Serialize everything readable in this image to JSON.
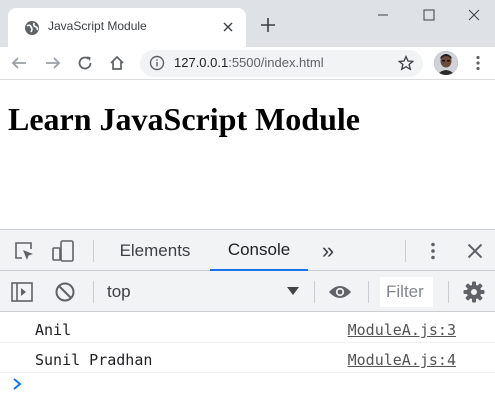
{
  "browser": {
    "tab_title": "JavaScript Module",
    "url_host": "127.0.0.1",
    "url_rest": ":5500/index.html"
  },
  "page": {
    "heading": "Learn JavaScript Module"
  },
  "devtools": {
    "tabs": [
      {
        "label": "Elements",
        "active": false
      },
      {
        "label": "Console",
        "active": true
      }
    ],
    "more_tabs_label": "»",
    "context": "top",
    "filter_placeholder": "Filter",
    "accent_color": "#1a73e8",
    "logs": [
      {
        "message": "Anil",
        "source": "ModuleA.js:3"
      },
      {
        "message": "Sunil Pradhan",
        "source": "ModuleA.js:4"
      }
    ]
  }
}
